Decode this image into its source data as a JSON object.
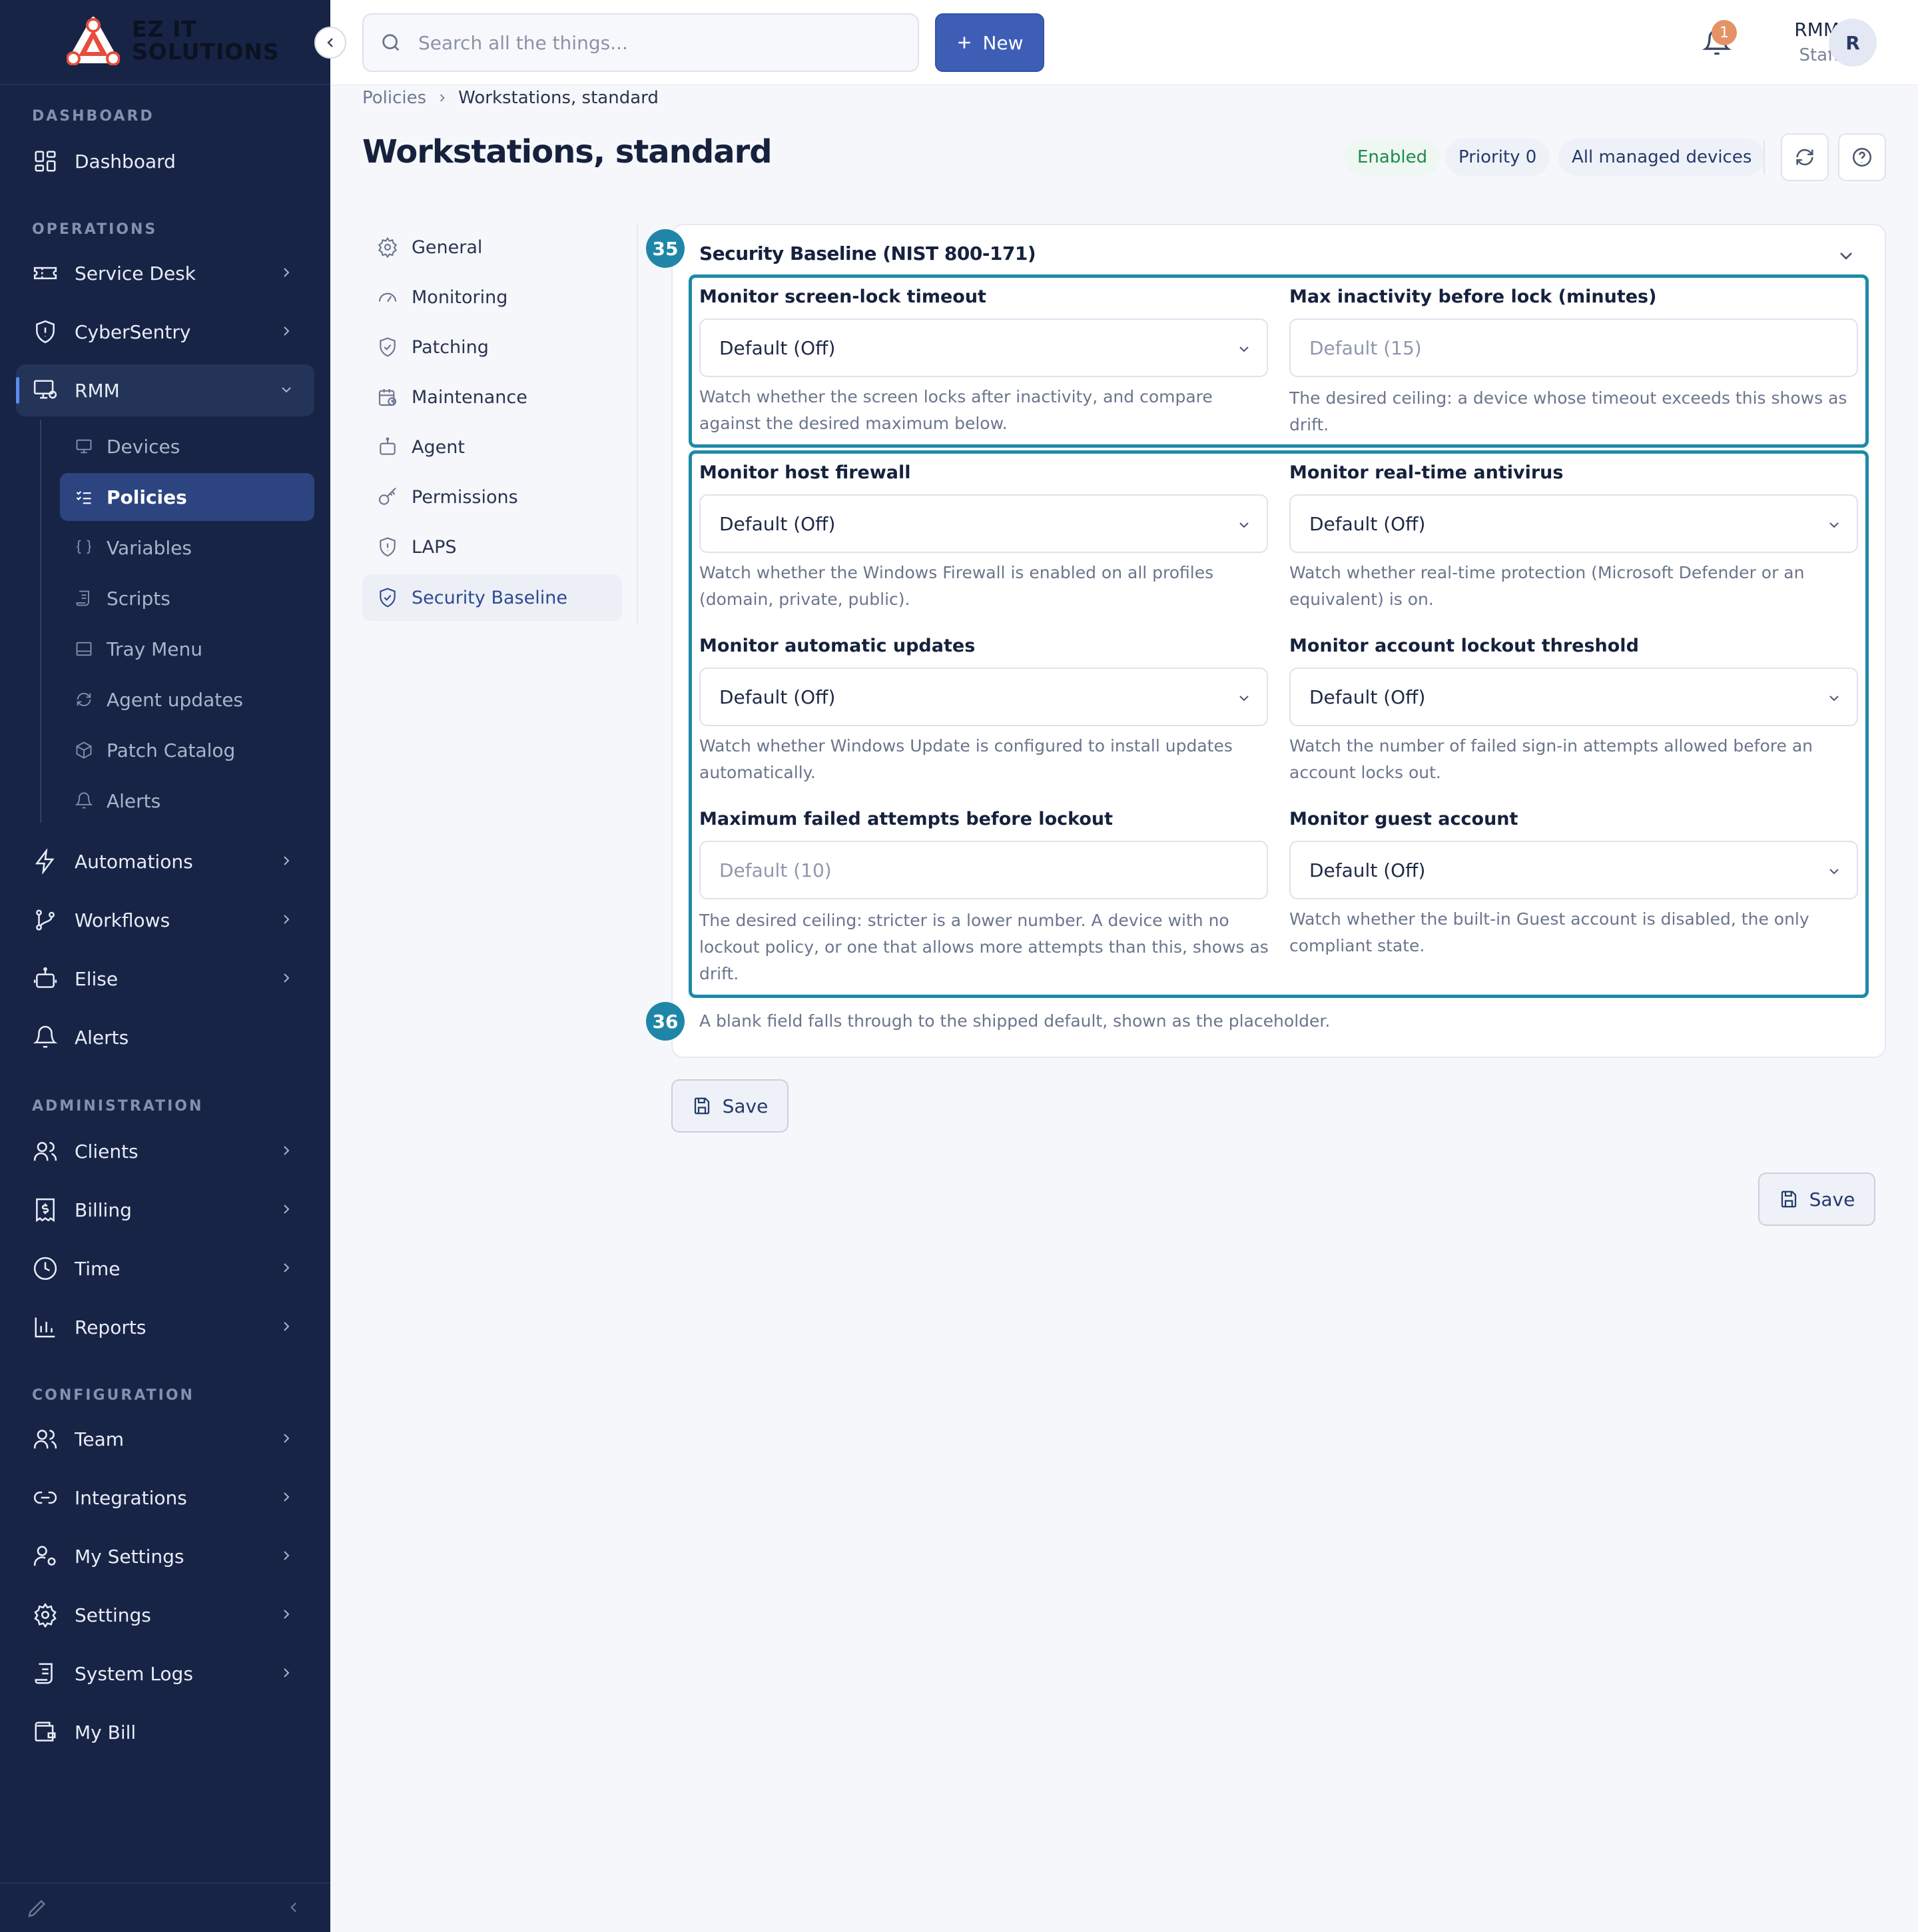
{
  "brand": {
    "line1": "EZ IT",
    "line2": "SOLUTIONS"
  },
  "topbar": {
    "search_placeholder": "Search all the things...",
    "new_label": "New",
    "notification_count": "1",
    "user_name": "RMM",
    "user_role": "Staff",
    "avatar_initial": "R"
  },
  "sidebar": {
    "sections": {
      "dashboard": "DASHBOARD",
      "operations": "OPERATIONS",
      "administration": "ADMINISTRATION",
      "configuration": "CONFIGURATION"
    },
    "items": {
      "dashboard": "Dashboard",
      "service_desk": "Service Desk",
      "cybersentry": "CyberSentry",
      "rmm": "RMM",
      "automations": "Automations",
      "workflows": "Workflows",
      "elise": "Elise",
      "alerts": "Alerts",
      "clients": "Clients",
      "billing": "Billing",
      "time": "Time",
      "reports": "Reports",
      "team": "Team",
      "integrations": "Integrations",
      "my_settings": "My Settings",
      "settings": "Settings",
      "system_logs": "System Logs",
      "my_bill": "My Bill"
    },
    "rmm_sub": {
      "devices": "Devices",
      "policies": "Policies",
      "variables": "Variables",
      "scripts": "Scripts",
      "tray_menu": "Tray Menu",
      "agent_updates": "Agent updates",
      "patch_catalog": "Patch Catalog",
      "alerts": "Alerts"
    }
  },
  "breadcrumb": {
    "parent": "Policies",
    "current": "Workstations, standard"
  },
  "page": {
    "title": "Workstations, standard",
    "status": "Enabled",
    "priority": "Priority 0",
    "scope": "All managed devices"
  },
  "tabs": {
    "general": "General",
    "monitoring": "Monitoring",
    "patching": "Patching",
    "maintenance": "Maintenance",
    "agent": "Agent",
    "permissions": "Permissions",
    "laps": "LAPS",
    "security_baseline": "Security Baseline"
  },
  "card": {
    "badge_top": "35",
    "badge_bottom": "36",
    "title": "Security Baseline (NIST 800-171)",
    "fields": {
      "screen_lock": {
        "label": "Monitor screen-lock timeout",
        "value": "Default (Off)",
        "help": "Watch whether the screen locks after inactivity, and compare against the desired maximum below."
      },
      "max_inactivity": {
        "label": "Max inactivity before lock (minutes)",
        "placeholder": "Default (15)",
        "help": "The desired ceiling: a device whose timeout exceeds this shows as drift."
      },
      "firewall": {
        "label": "Monitor host firewall",
        "value": "Default (Off)",
        "help": "Watch whether the Windows Firewall is enabled on all profiles (domain, private, public)."
      },
      "antivirus": {
        "label": "Monitor real-time antivirus",
        "value": "Default (Off)",
        "help": "Watch whether real-time protection (Microsoft Defender or an equivalent) is on."
      },
      "auto_updates": {
        "label": "Monitor automatic updates",
        "value": "Default (Off)",
        "help": "Watch whether Windows Update is configured to install updates automatically."
      },
      "lockout_threshold": {
        "label": "Monitor account lockout threshold",
        "value": "Default (Off)",
        "help": "Watch the number of failed sign-in attempts allowed before an account locks out."
      },
      "max_failed": {
        "label": "Maximum failed attempts before lockout",
        "placeholder": "Default (10)",
        "help": "The desired ceiling: stricter is a lower number. A device with no lockout policy, or one that allows more attempts than this, shows as drift."
      },
      "guest": {
        "label": "Monitor guest account",
        "value": "Default (Off)",
        "help": "Watch whether the built-in Guest account is disabled, the only compliant state."
      }
    },
    "footnote": "A blank field falls through to the shipped default, shown as the placeholder."
  },
  "actions": {
    "save_label": "Save",
    "save_label_2": "Save"
  },
  "colors": {
    "sidebar_bg": "#172446",
    "accent": "#3e5eb6",
    "highlight": "#1d8aa6",
    "enabled": "#1e8a4b"
  }
}
